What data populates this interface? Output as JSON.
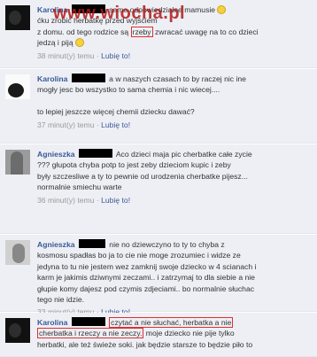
{
  "watermark": "www.wiocha.pl",
  "comments": [
    {
      "author": "Karolina",
      "lines": [
        "samo odpowiedzialne mamusie",
        "ćku zrobić herbatkę przed wyjściem",
        "z domu. od tego rodzice są",
        "rzeby",
        "zwracać uwagę na to co dzieci",
        "jedzą i piją"
      ],
      "time": "38 minut(y) temu",
      "like": "Lubię to!"
    },
    {
      "author": "Karolina",
      "lines": [
        "a w naszych czasach to by raczej nic ine",
        "mogły jesc bo wszystko to sama chemia i nic wiecej....",
        "to lepiej jeszcze więcej chemii dziecku dawać?"
      ],
      "time": "37 minut(y) temu",
      "like": "Lubię to!"
    },
    {
      "author": "Agnieszka",
      "lines": [
        "Aco dzieci maja pic cherbatke całe zycie",
        "??? głupota chyba potp to jest zeby dzieciom kupic i zeby",
        "były szczesliwe a ty to pewnie od urodzenia cherbatke pijesz...",
        "normalnie smiechu warte"
      ],
      "time": "36 minut(y) temu",
      "like": "Lubię to!"
    },
    {
      "author": "Agnieszka",
      "lines": [
        "nie no dziewczyno to ty to chyba z",
        "kosmosu spadłas bo ja to cie nie moge zrozumiec i widze ze",
        "jedyna to tu nie jestem wez zamknij swoje dziecko w 4 scianach i",
        "karm je jakimis dziwnymi zeczami.. i zatrzymaj to dla siebie a nie",
        "głupie komy dajesz pod czymis zdjeciami.. bo normalnie słuchac",
        "tego nie idzie."
      ],
      "time": "33 minut(y) temu",
      "like": "Lubię to!"
    },
    {
      "author": "Karolina",
      "lines": [
        "czytać a nie słuchać, herbatka a nie",
        "cherbatka i rzeczy a nie zeczy.",
        "moje dziecko nie pije tylko",
        "herbatki, ale też świeże soki. jak będzie starsze to będzie piło to"
      ]
    }
  ]
}
